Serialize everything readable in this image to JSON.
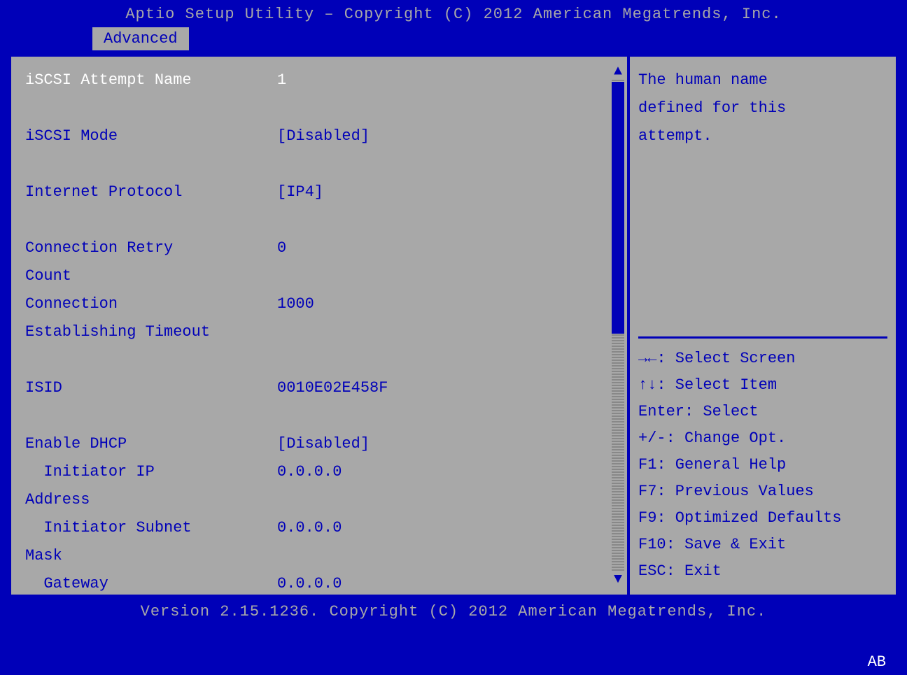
{
  "header": {
    "title": "Aptio Setup Utility – Copyright (C) 2012 American Megatrends, Inc."
  },
  "tabs": [
    {
      "label": "Advanced"
    }
  ],
  "settings": [
    {
      "label": "iSCSI Attempt Name",
      "value": "1",
      "selected": true,
      "indent": 0
    },
    {
      "spacer": true
    },
    {
      "label": "iSCSI Mode",
      "value": "[Disabled]",
      "indent": 0
    },
    {
      "spacer": true
    },
    {
      "label": "Internet Protocol",
      "value": "[IP4]",
      "indent": 0
    },
    {
      "spacer": true
    },
    {
      "label": "Connection Retry",
      "value": "0",
      "indent": 0
    },
    {
      "label": "Count",
      "value": "",
      "indent": 0
    },
    {
      "label": "Connection",
      "value": "1000",
      "indent": 0
    },
    {
      "label": "Establishing Timeout",
      "value": "",
      "indent": 0
    },
    {
      "spacer": true
    },
    {
      "label": "ISID",
      "value": "0010E02E458F",
      "indent": 0
    },
    {
      "spacer": true
    },
    {
      "label": "Enable DHCP",
      "value": "[Disabled]",
      "indent": 0
    },
    {
      "label": "  Initiator IP",
      "value": "0.0.0.0",
      "indent": 0
    },
    {
      "label": "Address",
      "value": "",
      "indent": 0
    },
    {
      "label": "  Initiator Subnet",
      "value": "0.0.0.0",
      "indent": 0
    },
    {
      "label": "Mask",
      "value": "",
      "indent": 0
    },
    {
      "label": "  Gateway",
      "value": "0.0.0.0",
      "indent": 0
    }
  ],
  "help": {
    "text": "The human name\ndefined for this\nattempt."
  },
  "keyhelp": [
    "→←: Select Screen",
    "↑↓: Select Item",
    "Enter: Select",
    "+/-: Change Opt.",
    "F1: General Help",
    "F7: Previous Values",
    "F9: Optimized Defaults",
    "F10: Save & Exit",
    "ESC: Exit"
  ],
  "footer": {
    "version": "Version 2.15.1236. Copyright (C) 2012 American Megatrends, Inc.",
    "badge": "AB"
  }
}
